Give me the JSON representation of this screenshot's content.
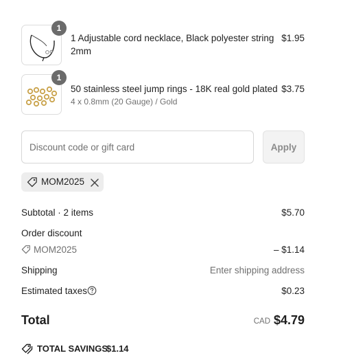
{
  "items": [
    {
      "name": "1 Adjustable cord necklace, Black polyester string 2mm",
      "variant": "",
      "quantity": "1",
      "price": "$1.95"
    },
    {
      "name": "50 stainless steel jump rings - 18K real gold plated",
      "variant": "4 x 0.8mm (20 Gauge) / Gold",
      "quantity": "1",
      "price": "$3.75"
    }
  ],
  "discount": {
    "placeholder": "Discount code or gift card",
    "apply_label": "Apply",
    "applied_code": "MOM2025"
  },
  "summary": {
    "subtotal_label": "Subtotal · 2 items",
    "subtotal_value": "$5.70",
    "order_discount_label": "Order discount",
    "discount_code": "MOM2025",
    "discount_value": "– $1.14",
    "shipping_label": "Shipping",
    "shipping_value": "Enter shipping address",
    "taxes_label": "Estimated taxes",
    "taxes_value": "$0.23"
  },
  "total": {
    "label": "Total",
    "currency": "CAD",
    "amount": "$4.79"
  },
  "savings": {
    "label": "TOTAL SAVINGS",
    "amount": "$1.14"
  },
  "icons": {
    "tag": "tag-icon",
    "remove": "close-icon",
    "help": "help-circle-icon",
    "savings": "tags-icon"
  },
  "colors": {
    "badge": "#6b6b6b",
    "chip_bg": "#ededed",
    "apply_bg": "#f3f3f3",
    "muted_text": "#707070"
  }
}
